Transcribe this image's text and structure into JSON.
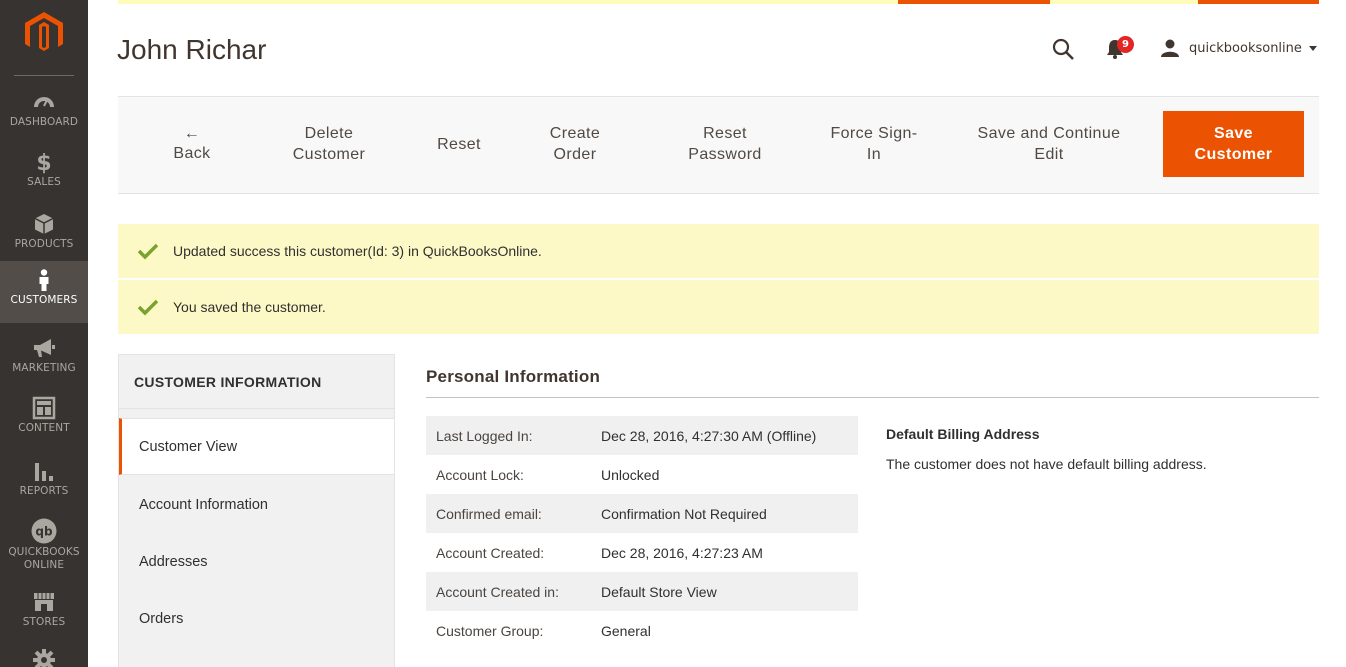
{
  "sidebar": {
    "items": [
      {
        "label": "DASHBOARD",
        "icon": "dashboard-icon"
      },
      {
        "label": "SALES",
        "icon": "dollar-icon"
      },
      {
        "label": "PRODUCTS",
        "icon": "cube-icon"
      },
      {
        "label": "CUSTOMERS",
        "icon": "person-icon",
        "active": true
      },
      {
        "label": "MARKETING",
        "icon": "megaphone-icon"
      },
      {
        "label": "CONTENT",
        "icon": "layout-icon"
      },
      {
        "label": "REPORTS",
        "icon": "bar-chart-icon"
      },
      {
        "label": "QUICKBOOKS",
        "label2": "ONLINE",
        "icon": "quickbooks-icon"
      },
      {
        "label": "STORES",
        "icon": "store-icon"
      }
    ]
  },
  "header": {
    "title": "John Richar",
    "notification_count": "9",
    "username": "quickbooksonline"
  },
  "toolbar": {
    "back_label": "Back",
    "delete_line1": "Delete",
    "delete_line2": "Customer",
    "reset_label": "Reset",
    "create_line1": "Create",
    "create_line2": "Order",
    "reset_pw_line1": "Reset",
    "reset_pw_line2": "Password",
    "force_line1": "Force Sign-",
    "force_line2": "In",
    "save_continue_line1": "Save and Continue",
    "save_continue_line2": "Edit",
    "save_line1": "Save",
    "save_line2": "Customer"
  },
  "messages": [
    "Updated success this customer(Id: 3) in QuickBooksOnline.",
    "You saved the customer."
  ],
  "tabs": {
    "title": "CUSTOMER INFORMATION",
    "items": [
      "Customer View",
      "Account Information",
      "Addresses",
      "Orders"
    ]
  },
  "personal": {
    "title": "Personal Information",
    "rows": [
      {
        "key": "Last Logged In:",
        "value": "Dec 28, 2016, 4:27:30 AM (Offline)"
      },
      {
        "key": "Account Lock:",
        "value": "Unlocked"
      },
      {
        "key": "Confirmed email:",
        "value": "Confirmation Not Required"
      },
      {
        "key": "Account Created:",
        "value": "Dec 28, 2016, 4:27:23 AM"
      },
      {
        "key": "Account Created in:",
        "value": "Default Store View"
      },
      {
        "key": "Customer Group:",
        "value": "General"
      }
    ]
  },
  "billing": {
    "title": "Default Billing Address",
    "text": "The customer does not have default billing address."
  },
  "colors": {
    "accent": "#eb5202",
    "sidebar_bg": "#373330",
    "message_bg": "#fdf9c6",
    "success_check": "#79a22e"
  }
}
